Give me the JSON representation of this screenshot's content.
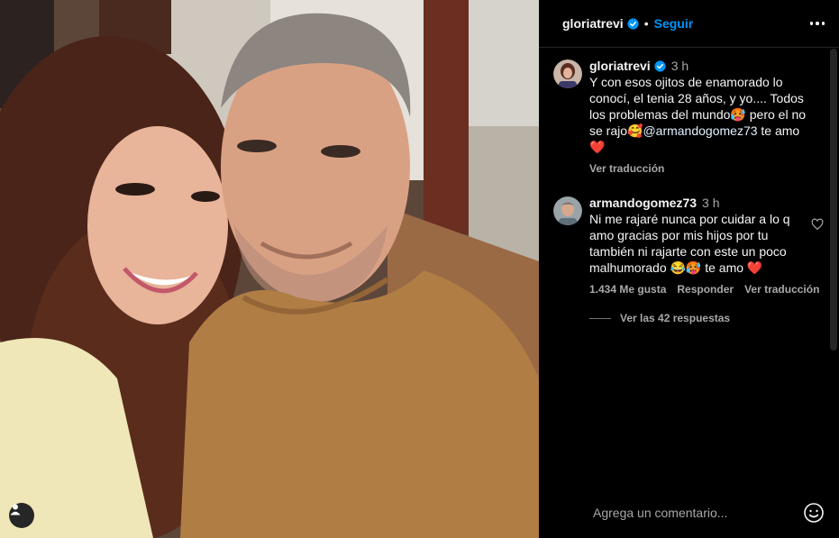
{
  "post": {
    "author": "gloriatrevi",
    "follow_label": "Seguir"
  },
  "caption": {
    "username": "gloriatrevi",
    "time": "3 h",
    "text_before_mention": "Y con esos ojitos de enamorado lo conocí, el tenia 28 años, y yo.... Todos los problemas del mundo🥵 pero el no se rajo🥰",
    "mention": "@armandogomez73",
    "text_after_mention": " te amo❤️",
    "translate_label": "Ver traducción"
  },
  "comment": {
    "username": "armandogomez73",
    "time": "3 h",
    "text": "Ni me rajaré nunca por cuidar a lo q amo gracias por mis hijos por tu también ni rajarte con este un poco malhumorado 😂🥵 te amo ❤️",
    "likes": "1.434 Me gusta",
    "reply_label": "Responder",
    "translate_label": "Ver traducción",
    "view_replies": "Ver las 42 respuestas"
  },
  "composer": {
    "placeholder": "Agrega un comentario..."
  },
  "icons": {
    "verified": "verified-badge-icon",
    "more": "more-options-icon",
    "heart": "heart-icon",
    "emoji": "emoji-icon",
    "tag": "user-tag-icon"
  },
  "colors": {
    "accent": "#0095f6",
    "background": "#000000",
    "secondary_text": "#a8a8a8"
  }
}
